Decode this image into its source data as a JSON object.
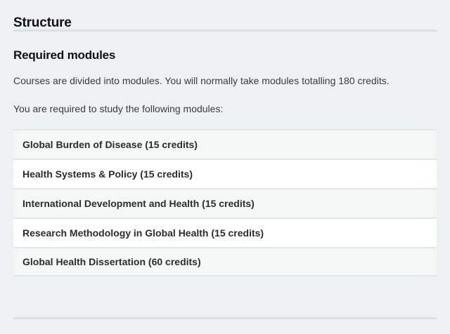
{
  "structure": {
    "title": "Structure"
  },
  "required_modules": {
    "title": "Required modules",
    "intro": "Courses are divided into modules. You will normally take modules totalling 180 credits.",
    "instruction": "You are required to study the following modules:",
    "modules": [
      {
        "label": "Global Burden of Disease (15 credits)"
      },
      {
        "label": "Health Systems & Policy (15 credits)"
      },
      {
        "label": "International Development and Health (15 credits)"
      },
      {
        "label": "Research Methodology in Global Health (15 credits)"
      },
      {
        "label": "Global Health Dissertation (60 credits)"
      }
    ]
  }
}
